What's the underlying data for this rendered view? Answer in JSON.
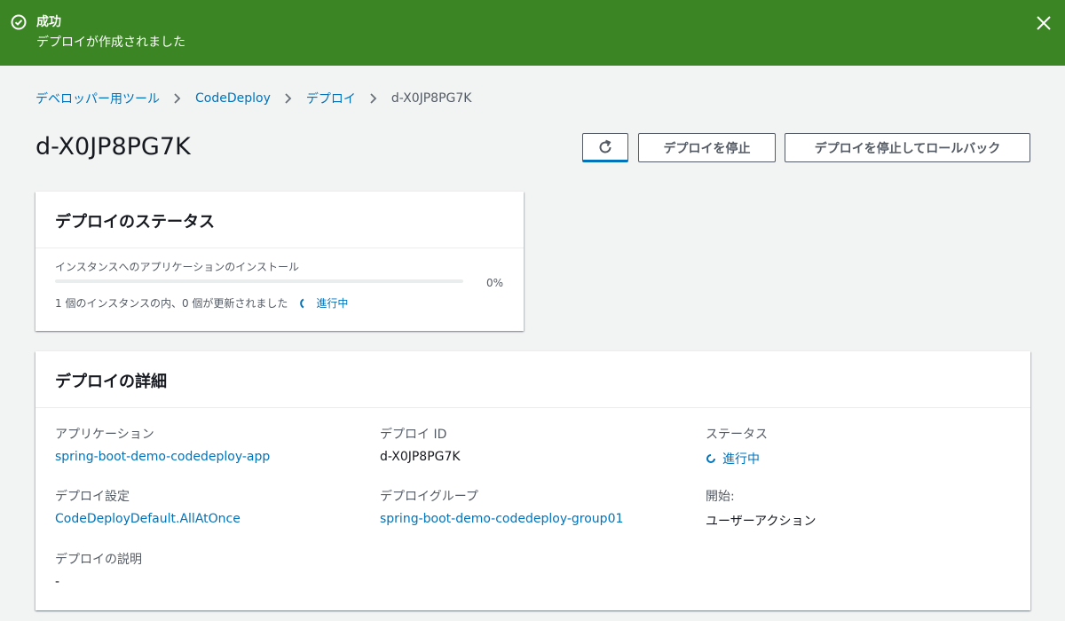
{
  "flash": {
    "title": "成功",
    "message": "デプロイが作成されました",
    "icon": "check-circle-icon",
    "color": "#3b8524"
  },
  "breadcrumb": [
    {
      "label": "デベロッパー用ツール"
    },
    {
      "label": "CodeDeploy"
    },
    {
      "label": "デプロイ"
    },
    {
      "label": "d-X0JP8PG7K"
    }
  ],
  "page": {
    "title": "d-X0JP8PG7K"
  },
  "actions": {
    "stop_label": "デプロイを停止",
    "rollback_label": "デプロイを停止してロールバック"
  },
  "status_panel": {
    "title": "デプロイのステータス",
    "progress_label": "インスタンスへのアプリケーションのインストール",
    "progress_percent_text": "0%",
    "progress_value": 0,
    "description": "1 個のインスタンスの内、0 個が更新されました",
    "state": "進行中"
  },
  "details_panel": {
    "title": "デプロイの詳細",
    "fields": [
      {
        "label": "アプリケーション",
        "value": "spring-boot-demo-codedeploy-app"
      },
      {
        "label": "デプロイ ID",
        "value": "d-X0JP8PG7K"
      },
      {
        "label": "ステータス",
        "value": "進行中"
      },
      {
        "label": "デプロイ設定",
        "value": "CodeDeployDefault.AllAtOnce"
      },
      {
        "label": "デプロイグループ",
        "value": "spring-boot-demo-codedeploy-group01"
      },
      {
        "label": "開始:",
        "value": "ユーザーアクション"
      },
      {
        "label": "デプロイの説明",
        "value": "-"
      }
    ]
  }
}
